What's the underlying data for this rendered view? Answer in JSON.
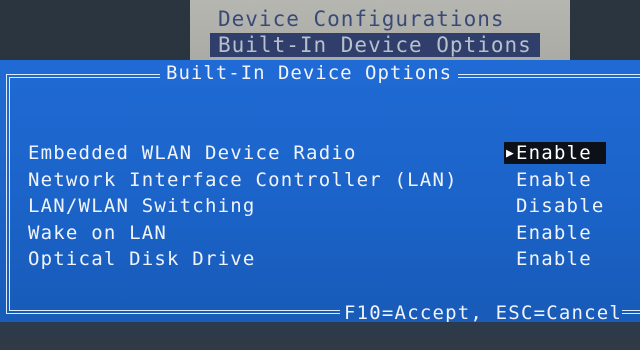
{
  "background_menu": {
    "items": [
      "Device Configurations",
      "Built-In Device Options"
    ],
    "selected_index": 1
  },
  "dialog": {
    "title": "Built-In Device Options",
    "rows": [
      {
        "label": "Embedded WLAN Device Radio",
        "value": "Enable",
        "selected": true
      },
      {
        "label": "Network Interface Controller (LAN)",
        "value": "Enable",
        "selected": false
      },
      {
        "label": "LAN/WLAN Switching",
        "value": "Disable",
        "selected": false
      },
      {
        "label": "Wake on LAN",
        "value": "Enable",
        "selected": false
      },
      {
        "label": "Optical Disk Drive",
        "value": "Enable",
        "selected": false
      }
    ],
    "pointer_glyph": "▶",
    "footer": "F10=Accept, ESC=Cancel"
  },
  "colors": {
    "dialog_blue": "#1f6ad4",
    "text": "#f0f4fa",
    "selection_bg": "#0c1018",
    "menu_grey": "#b9b9b4",
    "menu_highlight": "#2f3e6a"
  }
}
